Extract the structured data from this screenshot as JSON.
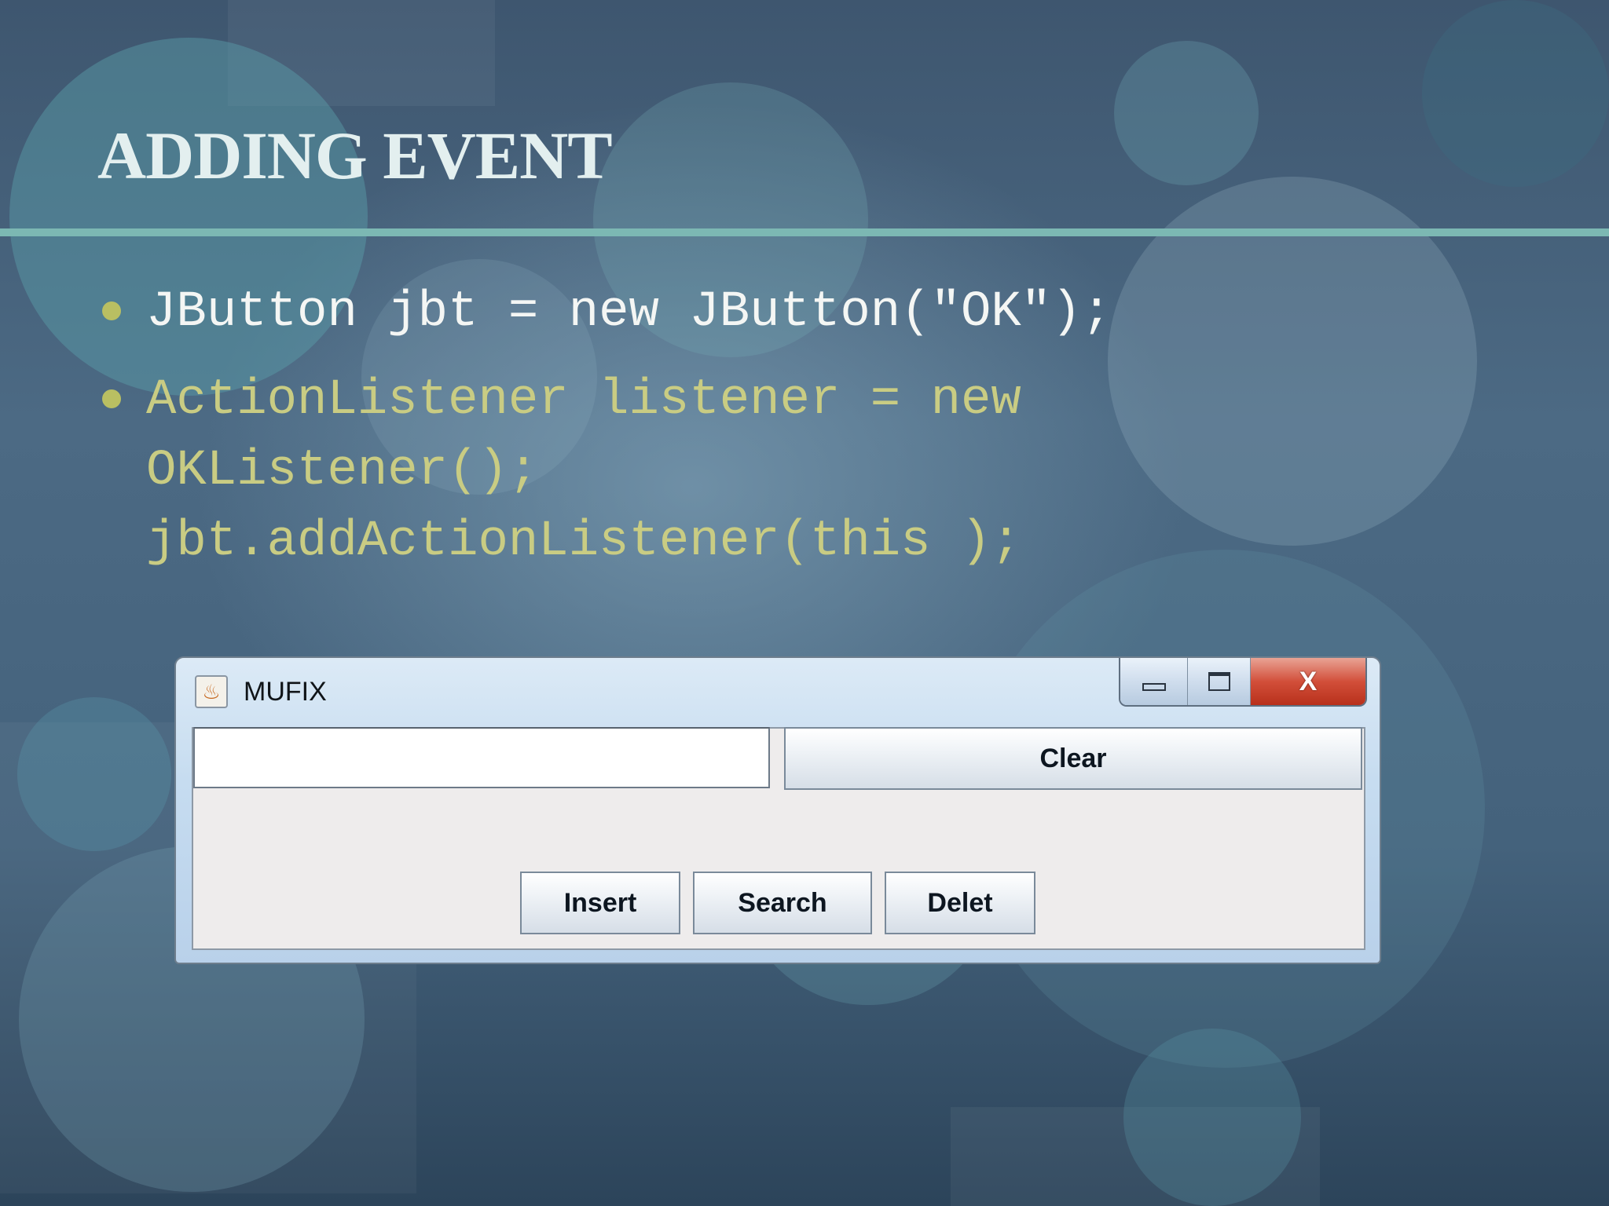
{
  "slide": {
    "title": "ADDING EVENT",
    "bullets": [
      {
        "text": "JButton jbt = new JButton(\"OK\");"
      },
      {
        "lines": [
          "ActionListener listener = new",
          "OKListener();",
          "jbt.addActionListener(this );"
        ]
      }
    ]
  },
  "window": {
    "title": "MUFIX",
    "icon": "java-cup-icon",
    "controls": {
      "minimize": "minimize-icon",
      "maximize": "maximize-icon",
      "close": "X"
    },
    "text_field": {
      "value": ""
    },
    "buttons": {
      "clear": "Clear",
      "insert": "Insert",
      "search": "Search",
      "delete": "Delet"
    }
  },
  "colors": {
    "title": "#e3efef",
    "rule": "#7cb8b3",
    "bullet": "#b9bf62",
    "highlight_text": "#c9cc83",
    "close_button": "#d24f3a"
  }
}
